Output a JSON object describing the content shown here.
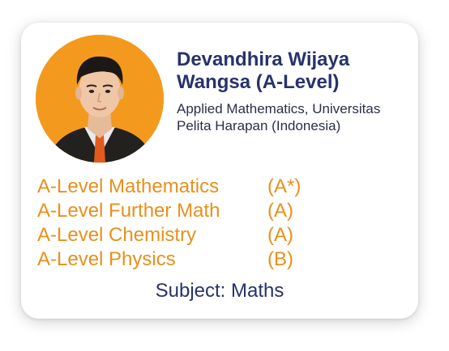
{
  "profile": {
    "name": "Devandhira Wijaya Wangsa (A-Level)",
    "program": "Applied Mathematics, Universitas Pelita Harapan (Indonesia)",
    "photo_icon": "student-portrait",
    "photo_background": "#f39a1e"
  },
  "results": [
    {
      "subject": "A-Level Mathematics",
      "grade": "(A*)"
    },
    {
      "subject": "A-Level Further Math",
      "grade": "(A)"
    },
    {
      "subject": "A-Level Chemistry",
      "grade": "(A)"
    },
    {
      "subject": "A-Level Physics",
      "grade": "(B)"
    }
  ],
  "footer": {
    "subject": "Subject: Maths"
  },
  "colors": {
    "accent": "#e8901c",
    "heading": "#27336b",
    "body_text": "#2a2f4a"
  }
}
